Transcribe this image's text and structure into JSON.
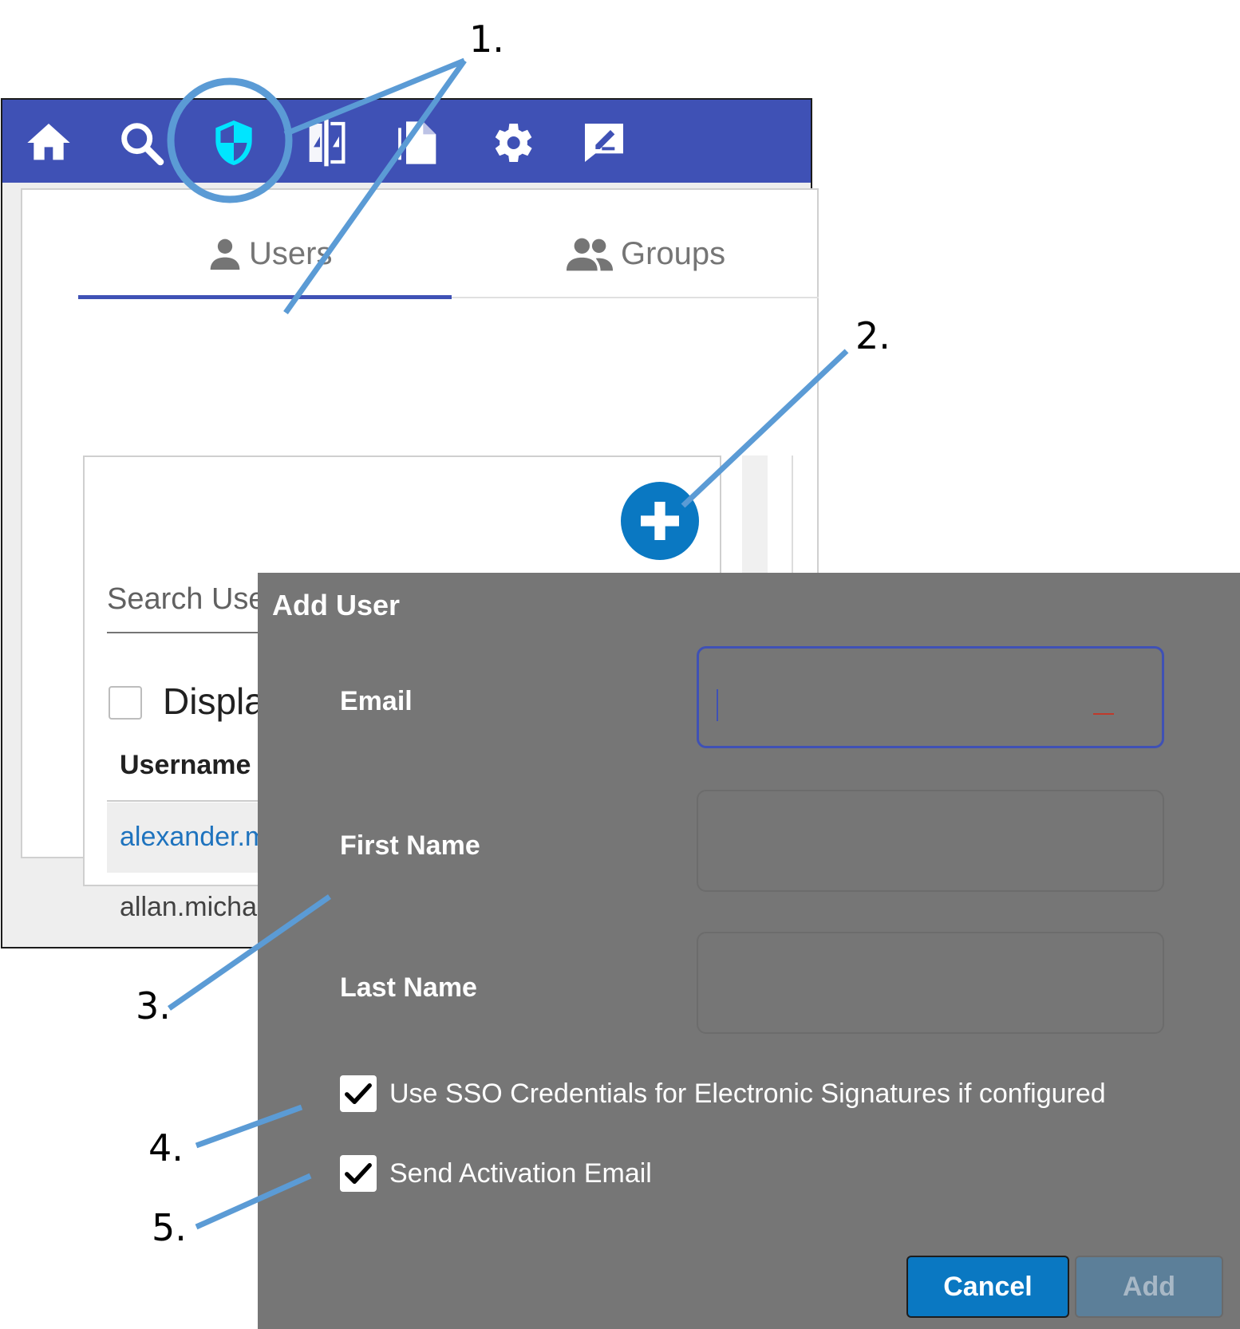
{
  "toolbar": {
    "color": "#3f51b5",
    "icons": [
      "home-icon",
      "search-icon",
      "security-shield-icon",
      "compare-icon",
      "document-icon",
      "settings-gear-icon",
      "signature-icon"
    ],
    "active_icon_color": "#00e5ff"
  },
  "tabs": {
    "users_label": "Users",
    "groups_label": "Groups",
    "active": "Users"
  },
  "users_panel": {
    "search_placeholder": "Search Use",
    "display_label": "Displa",
    "column_header": "Username",
    "rows": [
      {
        "username": "alexander.m"
      },
      {
        "username": "allan.micha"
      }
    ]
  },
  "dialog": {
    "title": "Add User",
    "email_label": "Email",
    "email_value": "",
    "first_name_label": "First Name",
    "first_name_value": "",
    "last_name_label": "Last Name",
    "last_name_value": "",
    "sso_label": "Use SSO Credentials for Electronic Signatures if configured",
    "sso_checked": true,
    "activation_label": "Send Activation Email",
    "activation_checked": true,
    "cancel_label": "Cancel",
    "add_label": "Add"
  },
  "annotations": {
    "color": "#5b9bd5",
    "callouts": [
      "1.",
      "2.",
      "3.",
      "4.",
      "5."
    ]
  }
}
